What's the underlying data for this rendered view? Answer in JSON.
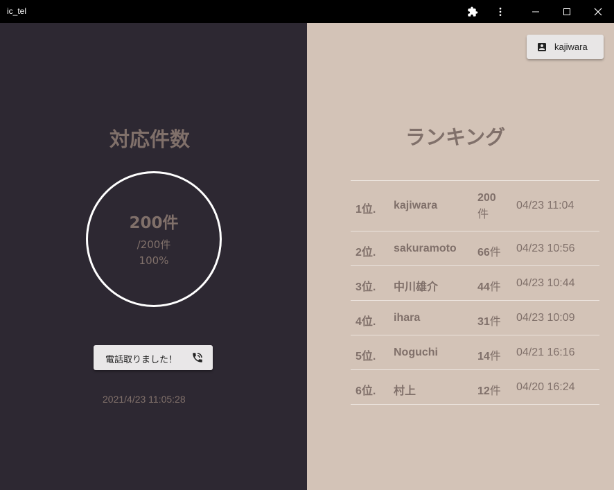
{
  "window": {
    "title": "ic_tel",
    "extension_icon": "puzzle-icon",
    "menu_icon": "more-vert-icon",
    "minimize_icon": "minimize-icon",
    "maximize_icon": "maximize-icon",
    "close_icon": "close-icon"
  },
  "left": {
    "heading": "対応件数",
    "count_main": "200件",
    "count_total": "/200件",
    "count_percent": "100%",
    "progress": 1.0,
    "call_button_label": "電話取りました！",
    "call_button_icon": "phone-callback-icon",
    "datetime": "2021/4/23 11:05:28"
  },
  "right": {
    "user_button_label": "kajiwara",
    "user_button_icon": "account-box-icon",
    "heading": "ランキング",
    "ranking": [
      {
        "rank": "1位.",
        "name": "kajiwara",
        "count": "200",
        "unit": "件",
        "time": "04/23 11:04"
      },
      {
        "rank": "2位.",
        "name": "sakuramoto",
        "count": "66",
        "unit": "件",
        "time": "04/23 10:56"
      },
      {
        "rank": "3位.",
        "name": "中川雄介",
        "count": "44",
        "unit": "件",
        "time": "04/23 10:44"
      },
      {
        "rank": "4位.",
        "name": "ihara",
        "count": "31",
        "unit": "件",
        "time": "04/23 10:09"
      },
      {
        "rank": "5位.",
        "name": "Noguchi",
        "count": "14",
        "unit": "件",
        "time": "04/21 16:16"
      },
      {
        "rank": "6位.",
        "name": "村上",
        "count": "12",
        "unit": "件",
        "time": "04/20 16:24"
      }
    ]
  },
  "colors": {
    "left_bg": "#2d2832",
    "right_bg": "#d3c3b7",
    "text_muted": "#80706a"
  }
}
